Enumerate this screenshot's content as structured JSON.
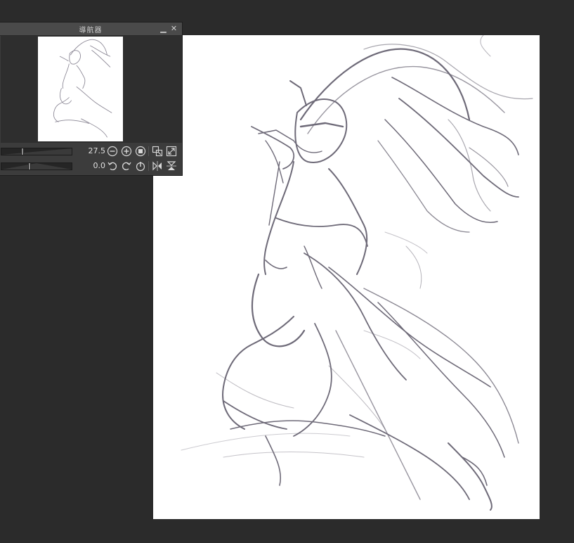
{
  "navigator": {
    "title": "導航器",
    "zoom_value": "27.5",
    "rotation_value": "0.0",
    "zoom_level_fraction": 0.3,
    "rotation_level_fraction": 0.4,
    "icons": {
      "zoom_out": "zoom-out-icon",
      "zoom_in": "zoom-in-icon",
      "fit": "fit-to-window-icon",
      "actual_size": "actual-pixels-icon",
      "fit_window": "fit-screen-icon",
      "rotate_left": "rotate-left-icon",
      "rotate_right": "rotate-right-icon",
      "reset_rotation": "reset-rotation-icon",
      "flip_horizontal": "flip-horizontal-icon",
      "flip_vertical": "flip-vertical-icon"
    }
  },
  "colors": {
    "workspace": "#2b2b2b",
    "panel": "#3c3c3c",
    "paper": "#ffffff",
    "sketch_stroke": "#6e6a78"
  }
}
